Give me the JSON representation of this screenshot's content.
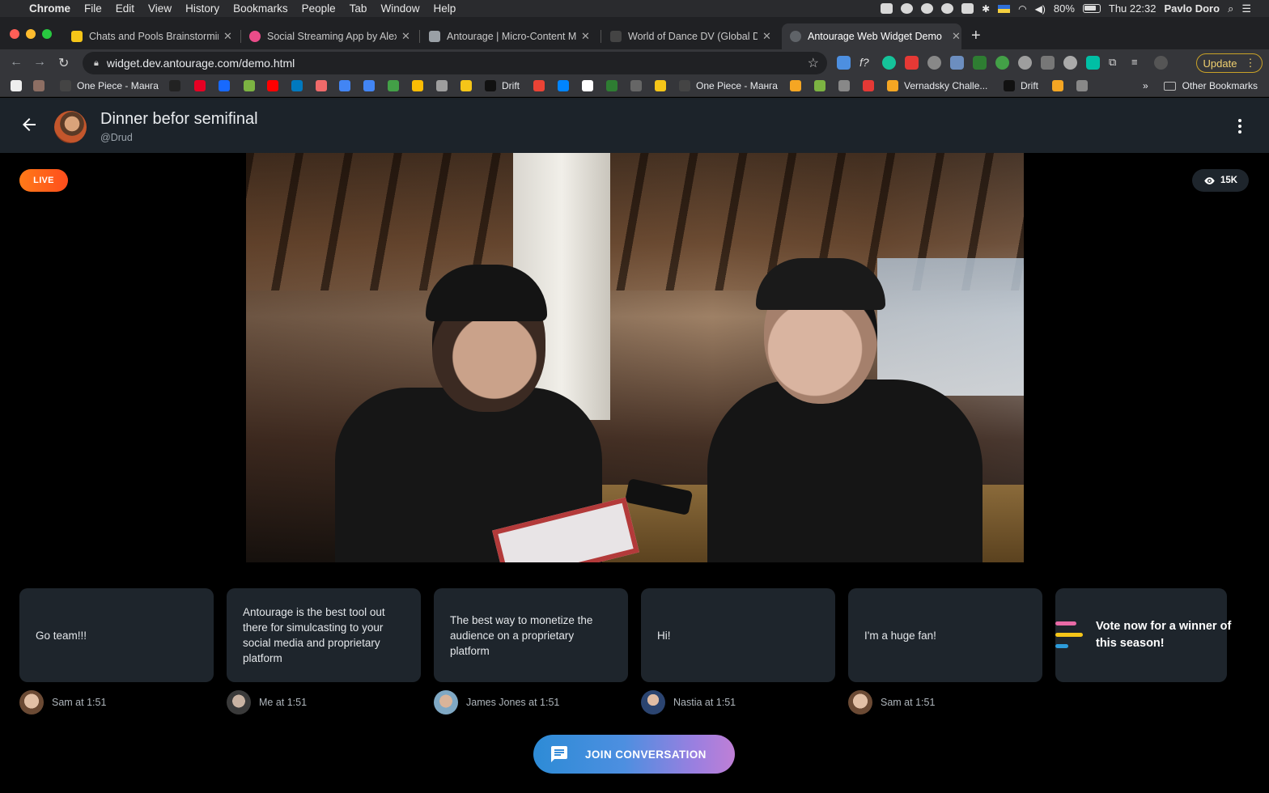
{
  "menubar": {
    "app_name": "Chrome",
    "items": [
      "File",
      "Edit",
      "View",
      "History",
      "Bookmarks",
      "People",
      "Tab",
      "Window",
      "Help"
    ],
    "battery": "80%",
    "clock": "Thu 22:32",
    "user": "Pavlo Doro"
  },
  "tabs": [
    {
      "title": "Chats and Pools Brainstorming",
      "favicon_color": "#f5c518"
    },
    {
      "title": "Social Streaming App by Alex.S",
      "favicon_color": "#ea4c89"
    },
    {
      "title": "Antourage | Micro-Content Ma",
      "favicon_color": "#9aa0a6"
    },
    {
      "title": "World of Dance DV (Global Dan",
      "favicon_color": "#444444"
    },
    {
      "title": "Antourage Web Widget Demo",
      "favicon_color": "#5f6368",
      "active": true
    }
  ],
  "toolbar": {
    "url": "widget.dev.antourage.com/demo.html",
    "update_label": "Update"
  },
  "bookmarks": [
    {
      "label": "",
      "icon": "medium-icon"
    },
    {
      "label": "",
      "icon": "page-icon"
    },
    {
      "label": "One Piece - Манга",
      "icon": "manga-icon"
    },
    {
      "label": "",
      "icon": "gsap-icon"
    },
    {
      "label": "",
      "icon": "pinterest-icon"
    },
    {
      "label": "",
      "icon": "behance-icon"
    },
    {
      "label": "",
      "icon": "figure-icon"
    },
    {
      "label": "",
      "icon": "youtube-icon"
    },
    {
      "label": "",
      "icon": "trello-icon"
    },
    {
      "label": "",
      "icon": "asana-icon"
    },
    {
      "label": "",
      "icon": "translate-icon"
    },
    {
      "label": "",
      "icon": "calendar-icon"
    },
    {
      "label": "",
      "icon": "evernote-icon"
    },
    {
      "label": "",
      "icon": "drive-icon"
    },
    {
      "label": "",
      "icon": "circle-icon"
    },
    {
      "label": "",
      "icon": "coin-icon"
    },
    {
      "label": "Drift",
      "icon": "drift-icon"
    },
    {
      "label": "",
      "icon": "gmail-icon"
    },
    {
      "label": "",
      "icon": "messenger-icon"
    },
    {
      "label": "",
      "icon": "clock-icon"
    },
    {
      "label": "",
      "icon": "green-icon"
    },
    {
      "label": "",
      "icon": "e-icon"
    },
    {
      "label": "",
      "icon": "miro-icon"
    },
    {
      "label": "One Piece - Манга",
      "icon": "manga-icon"
    },
    {
      "label": "",
      "icon": "yellow-icon"
    },
    {
      "label": "",
      "icon": "figure-icon"
    },
    {
      "label": "",
      "icon": "folder-icon"
    },
    {
      "label": "",
      "icon": "record-icon"
    },
    {
      "label": "Vernadsky Challe...",
      "icon": "vernadsky-icon"
    },
    {
      "label": "Drift",
      "icon": "drift-icon"
    },
    {
      "label": "",
      "icon": "yellow-icon"
    },
    {
      "label": "",
      "icon": "folder-icon"
    }
  ],
  "other_bookmarks": "Other Bookmarks",
  "overflow": "»",
  "header": {
    "title": "Dinner befor semifinal",
    "handle": "@Drud"
  },
  "stream": {
    "live_label": "LIVE",
    "viewers": "15K"
  },
  "messages": [
    {
      "text": "Go team!!!",
      "author": "Sam at 1:51",
      "avatar_color": "#c9a58c"
    },
    {
      "text": "Antourage is the best tool out there for simulcasting to your social media and proprietary platform",
      "author": "Me at 1:51",
      "avatar_color": "#8a8f94"
    },
    {
      "text": "The best way to monetize the audience on a proprietary platform",
      "author": "James Jones at 1:51",
      "avatar_color": "#7fa8c4"
    },
    {
      "text": "Hi!",
      "author": "Nastia at 1:51",
      "avatar_color": "#3c5a86"
    },
    {
      "text": "I'm a huge fan!",
      "author": "Sam at 1:51",
      "avatar_color": "#c9a58c"
    }
  ],
  "poll": {
    "text": "Vote now for a winner of this season!",
    "bar_colors": [
      "#e86aa6",
      "#f5c518",
      "#2d9cdb"
    ]
  },
  "join_button": "JOIN CONVERSATION"
}
